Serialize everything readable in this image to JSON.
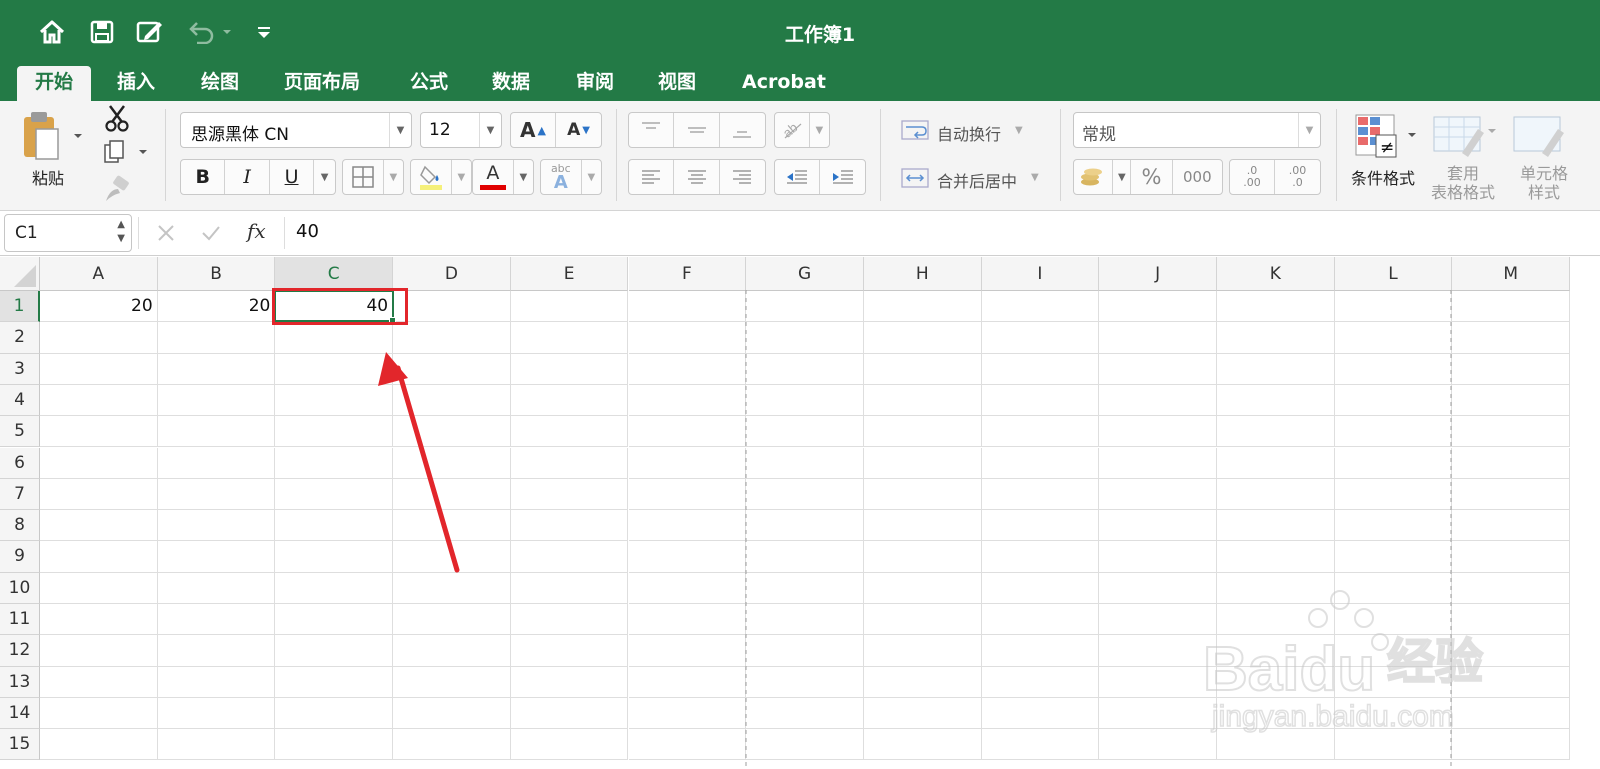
{
  "window": {
    "title": "工作簿1"
  },
  "quick_access": {
    "home_icon": "home-icon",
    "save_icon": "save-icon",
    "edit_icon": "edit-icon",
    "undo_icon": "undo-icon",
    "customize_icon": "chevron-down-icon"
  },
  "tabs": [
    {
      "label": "开始",
      "active": true
    },
    {
      "label": "插入"
    },
    {
      "label": "绘图"
    },
    {
      "label": "页面布局"
    },
    {
      "label": "公式"
    },
    {
      "label": "数据"
    },
    {
      "label": "审阅"
    },
    {
      "label": "视图"
    },
    {
      "label": "Acrobat"
    }
  ],
  "ribbon": {
    "paste_label": "粘贴",
    "font_name": "思源黑体 CN",
    "font_size": "12",
    "bold": "B",
    "italic": "I",
    "underline": "U",
    "font_color_glyph": "A",
    "grow_font_glyph": "A",
    "shrink_font_glyph": "A",
    "phonetic_small": "abc",
    "phonetic_big": "A",
    "wrap_text": "自动换行",
    "merge_center": "合并后居中",
    "number_format": "常规",
    "percent": "%",
    "thousands": "000",
    "inc_decimal_top": ".0",
    "inc_decimal_bottom": ".00",
    "dec_decimal_top": ".00",
    "dec_decimal_bottom": ".0",
    "conditional_format": "条件格式",
    "table_format_line1": "套用",
    "table_format_line2": "表格格式",
    "cell_style_line1": "单元格",
    "cell_style_line2": "样式",
    "accent_color": "#237a46",
    "font_color": "#e00000",
    "fill_color": "#f5f07a"
  },
  "formula_bar": {
    "cell_ref": "C1",
    "fx": "fx",
    "value": "40"
  },
  "sheet": {
    "columns": [
      "A",
      "B",
      "C",
      "D",
      "E",
      "F",
      "G",
      "H",
      "I",
      "J",
      "K",
      "L",
      "M"
    ],
    "rows": [
      "1",
      "2",
      "3",
      "4",
      "5",
      "6",
      "7",
      "8",
      "9",
      "10",
      "11",
      "12",
      "13",
      "14",
      "15"
    ],
    "selected_cell": "C1",
    "cells": {
      "A1": "20",
      "B1": "20",
      "C1": "40"
    }
  },
  "annotation": {
    "color": "#e2262b"
  },
  "watermark": {
    "brand": "Baidu",
    "product": "经验",
    "url": "jingyan.baidu.com"
  }
}
